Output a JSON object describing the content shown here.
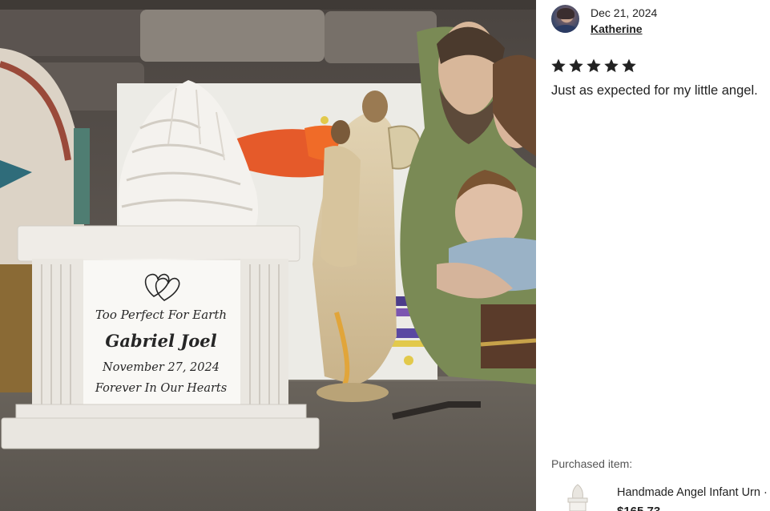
{
  "photo": {
    "alt": "Customer photo of a white angel-wing memorial urn",
    "urn_plaque": {
      "line1": "Too Perfect For Earth",
      "line2": "Gabriel Joel",
      "line3": "November 27, 2024",
      "line4": "Forever In Our Hearts"
    }
  },
  "review": {
    "date": "Dec 21, 2024",
    "author": "Katherine",
    "rating": 5,
    "rating_max": 5,
    "text": "Just as expected for my little angel."
  },
  "purchased": {
    "label": "Purchased item:",
    "title": "Handmade Angel Infant Urn ·",
    "price": "$165.73"
  },
  "colors": {
    "star": "#222222",
    "text": "#222222",
    "muted": "#555555"
  }
}
